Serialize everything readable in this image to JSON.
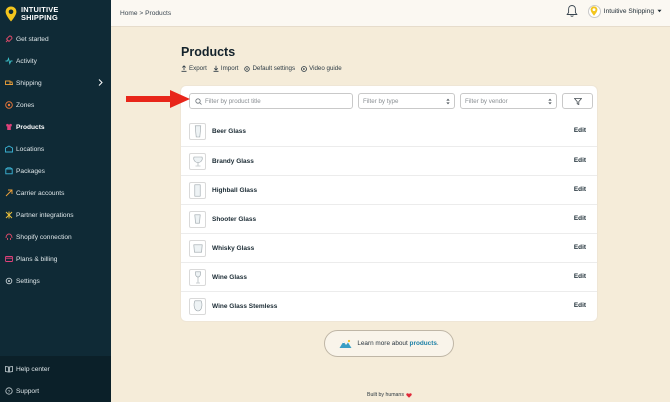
{
  "brand": {
    "line1": "INTUITIVE",
    "line2": "SHIPPING",
    "accent": "#f3c51d"
  },
  "sidebar": {
    "items": [
      {
        "label": "Get started",
        "icon": "rocket-icon"
      },
      {
        "label": "Activity",
        "icon": "activity-icon"
      },
      {
        "label": "Shipping",
        "icon": "shipping-icon",
        "has_chevron": true
      },
      {
        "label": "Zones",
        "icon": "zones-icon"
      },
      {
        "label": "Products",
        "icon": "products-icon",
        "active": true
      },
      {
        "label": "Locations",
        "icon": "locations-icon"
      },
      {
        "label": "Packages",
        "icon": "packages-icon"
      },
      {
        "label": "Carrier accounts",
        "icon": "carrier-icon"
      },
      {
        "label": "Partner integrations",
        "icon": "integrations-icon"
      },
      {
        "label": "Shopify connection",
        "icon": "shopify-icon"
      },
      {
        "label": "Plans & billing",
        "icon": "billing-icon"
      },
      {
        "label": "Settings",
        "icon": "settings-icon"
      }
    ],
    "bottom": [
      {
        "label": "Help center",
        "icon": "help-icon"
      },
      {
        "label": "Support",
        "icon": "support-icon"
      }
    ]
  },
  "topbar": {
    "breadcrumb": "Home > Products",
    "account_name": "Intuitive Shipping"
  },
  "page": {
    "title": "Products",
    "actions": [
      {
        "label": "Export",
        "icon": "upload-icon"
      },
      {
        "label": "Import",
        "icon": "download-icon"
      },
      {
        "label": "Default settings",
        "icon": "gear-icon"
      },
      {
        "label": "Video guide",
        "icon": "play-icon"
      }
    ]
  },
  "filters": {
    "search_placeholder": "Filter by product title",
    "type_placeholder": "Filter by type",
    "vendor_placeholder": "Filter by vendor"
  },
  "products": [
    {
      "name": "Beer Glass",
      "edit": "Edit"
    },
    {
      "name": "Brandy Glass",
      "edit": "Edit"
    },
    {
      "name": "Highball Glass",
      "edit": "Edit"
    },
    {
      "name": "Shooter Glass",
      "edit": "Edit"
    },
    {
      "name": "Whisky Glass",
      "edit": "Edit"
    },
    {
      "name": "Wine Glass",
      "edit": "Edit"
    },
    {
      "name": "Wine Glass Stemless",
      "edit": "Edit"
    }
  ],
  "learn_more": {
    "prefix": "Learn more about",
    "link": "products",
    "suffix": "."
  },
  "footer": {
    "text": "Built by humans"
  },
  "colors": {
    "sidebar_bg": "#0f2a36",
    "page_bg": "#f5ecd9",
    "arrow": "#e8261a",
    "link": "#1b7fa6"
  }
}
